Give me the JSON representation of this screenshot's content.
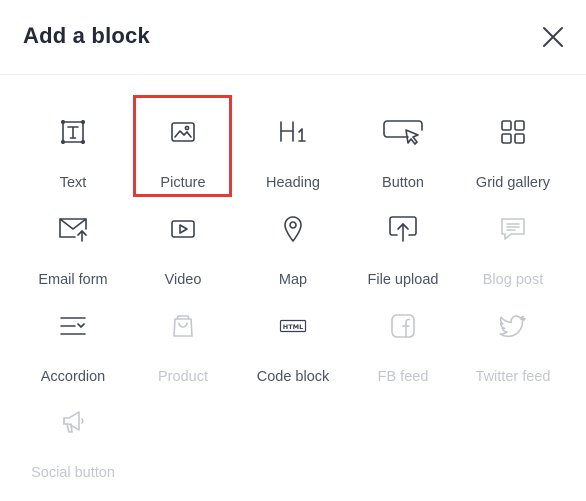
{
  "dialog": {
    "title": "Add a block",
    "close_icon": "close-icon"
  },
  "blocks": [
    {
      "label": "Text",
      "icon": "text-icon",
      "enabled": true
    },
    {
      "label": "Picture",
      "icon": "picture-icon",
      "enabled": true,
      "highlighted": true
    },
    {
      "label": "Heading",
      "icon": "heading-icon",
      "enabled": true
    },
    {
      "label": "Button",
      "icon": "button-icon",
      "enabled": true
    },
    {
      "label": "Grid gallery",
      "icon": "grid-gallery-icon",
      "enabled": true
    },
    {
      "label": "Email form",
      "icon": "email-form-icon",
      "enabled": true
    },
    {
      "label": "Video",
      "icon": "video-icon",
      "enabled": true
    },
    {
      "label": "Map",
      "icon": "map-pin-icon",
      "enabled": true
    },
    {
      "label": "File upload",
      "icon": "file-upload-icon",
      "enabled": true
    },
    {
      "label": "Blog post",
      "icon": "blog-post-icon",
      "enabled": false
    },
    {
      "label": "Accordion",
      "icon": "accordion-icon",
      "enabled": true
    },
    {
      "label": "Product",
      "icon": "product-icon",
      "enabled": false
    },
    {
      "label": "Code block",
      "icon": "code-block-icon",
      "enabled": true,
      "icon_text": "HTML"
    },
    {
      "label": "FB feed",
      "icon": "facebook-icon",
      "enabled": false
    },
    {
      "label": "Twitter feed",
      "icon": "twitter-icon",
      "enabled": false
    },
    {
      "label": "Social button",
      "icon": "megaphone-icon",
      "enabled": false
    }
  ],
  "colors": {
    "highlight": "#e53935",
    "disabled_text": "#c3c7cd",
    "text": "#4b5261"
  }
}
